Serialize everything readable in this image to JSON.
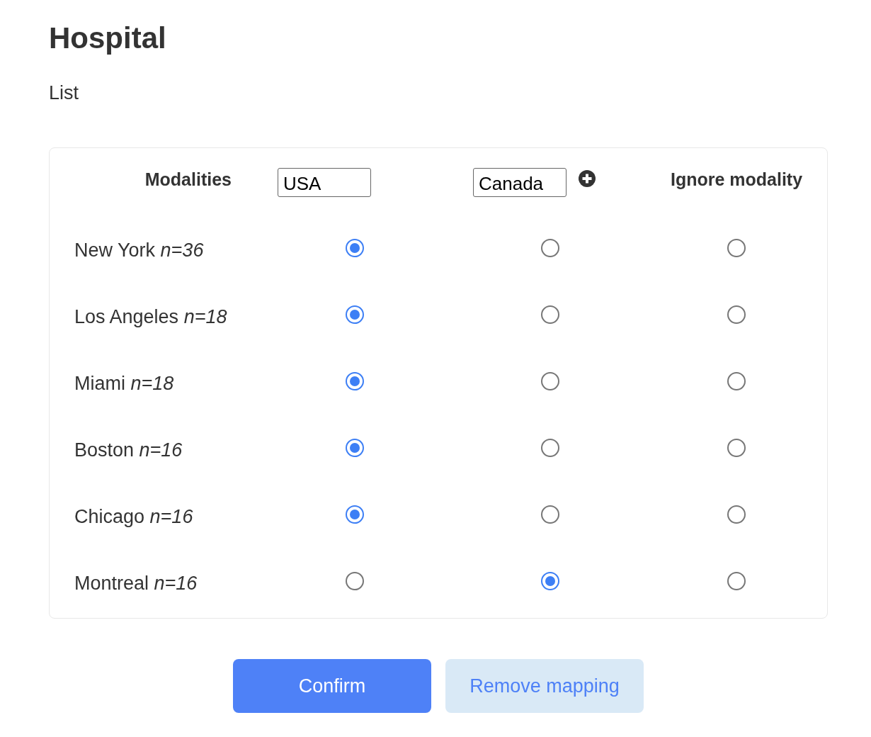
{
  "title": "Hospital",
  "subtitle": "List",
  "mapping": {
    "header_label": "Modalities",
    "columns": [
      {
        "kind": "input",
        "value": "USA"
      },
      {
        "kind": "input",
        "value": "Canada",
        "add_button": true
      },
      {
        "kind": "label",
        "label": "Ignore modality"
      }
    ],
    "rows": [
      {
        "label": "New York *n=36*",
        "choices": [
          {
            "selected": true
          },
          {
            "selected": false
          },
          {
            "selected": false
          }
        ]
      },
      {
        "label": "Los Angeles *n=18*",
        "choices": [
          {
            "selected": true
          },
          {
            "selected": false
          },
          {
            "selected": false
          }
        ]
      },
      {
        "label": "Miami *n=18*",
        "choices": [
          {
            "selected": true
          },
          {
            "selected": false
          },
          {
            "selected": false
          }
        ]
      },
      {
        "label": "Boston *n=16*",
        "choices": [
          {
            "selected": true
          },
          {
            "selected": false
          },
          {
            "selected": false
          }
        ]
      },
      {
        "label": "Chicago *n=16*",
        "choices": [
          {
            "selected": true
          },
          {
            "selected": false
          },
          {
            "selected": false
          }
        ]
      },
      {
        "label": "Montreal *n=16*",
        "choices": [
          {
            "selected": false
          },
          {
            "selected": true
          },
          {
            "selected": false
          }
        ]
      }
    ]
  },
  "buttons": [
    {
      "label": "Confirm",
      "kind": "primary"
    },
    {
      "label": "Remove mapping",
      "kind": "secondary"
    }
  ]
}
